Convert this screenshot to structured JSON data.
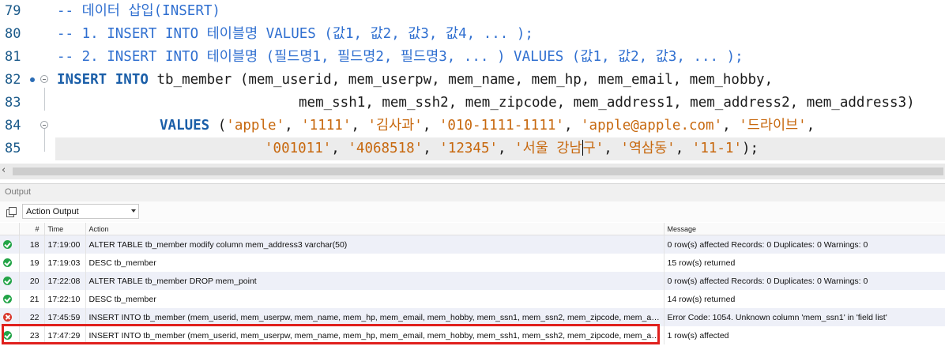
{
  "editor": {
    "lines": [
      {
        "num": "79",
        "comment": "-- 데이터 삽입(INSERT)"
      },
      {
        "num": "80",
        "comment": "-- 1. INSERT INTO 테이블명 VALUES (값1, 값2, 값3, 값4, ... );"
      },
      {
        "num": "81",
        "comment": "-- 2. INSERT INTO 테이블명 (필드명1, 필드명2, 필드명3, ... ) VALUES (값1, 값2, 값3, ... );"
      },
      {
        "num": "82",
        "kw1": "INSERT",
        "kw2": "INTO",
        "text": " tb_member (mem_userid, mem_userpw, mem_name, mem_hp, mem_email, mem_hobby,"
      },
      {
        "num": "83",
        "text": "mem_ssh1, mem_ssh2, mem_zipcode, mem_address1, mem_address2, mem_address3)"
      },
      {
        "num": "84",
        "kw": "VALUES",
        "s1": "'apple'",
        "s2": "'1111'",
        "s3": "'김사과'",
        "s4": "'010-1111-1111'",
        "s5": "'apple@apple.com'",
        "s6": "'드라이브'"
      },
      {
        "num": "85",
        "s1": "'001011'",
        "s2": "'4068518'",
        "s3": "'12345'",
        "s4a": "'서울 강남",
        "s4b": "구'",
        "s5": "'역삼동'",
        "s6": "'11-1'"
      }
    ]
  },
  "output": {
    "panel_title": "Output",
    "selector_value": "Action Output",
    "columns": [
      "#",
      "Time",
      "Action",
      "Message"
    ],
    "rows": [
      {
        "status": "ok",
        "num": "18",
        "time": "17:19:00",
        "action": "ALTER TABLE tb_member modify column mem_address3 varchar(50)",
        "message": "0 row(s) affected Records: 0  Duplicates: 0  Warnings: 0"
      },
      {
        "status": "ok",
        "num": "19",
        "time": "17:19:03",
        "action": "DESC tb_member",
        "message": "15 row(s) returned"
      },
      {
        "status": "ok",
        "num": "20",
        "time": "17:22:08",
        "action": "ALTER TABLE tb_member DROP mem_point",
        "message": "0 row(s) affected Records: 0  Duplicates: 0  Warnings: 0"
      },
      {
        "status": "ok",
        "num": "21",
        "time": "17:22:10",
        "action": "DESC tb_member",
        "message": "14 row(s) returned"
      },
      {
        "status": "error",
        "num": "22",
        "time": "17:45:59",
        "action": "INSERT INTO tb_member (mem_userid, mem_userpw, mem_name, mem_hp, mem_email, mem_hobby,  mem_ssn1, mem_ssn2, mem_zipcode, mem_ad...",
        "message": "Error Code: 1054. Unknown column 'mem_ssn1' in 'field list'"
      },
      {
        "status": "ok",
        "num": "23",
        "time": "17:47:29",
        "action": "INSERT INTO tb_member (mem_userid, mem_userpw, mem_name, mem_hp, mem_email, mem_hobby,  mem_ssh1, mem_ssh2, mem_zipcode, mem_ad...",
        "message": "1 row(s) affected"
      }
    ],
    "highlight_color": "#e0201d"
  }
}
